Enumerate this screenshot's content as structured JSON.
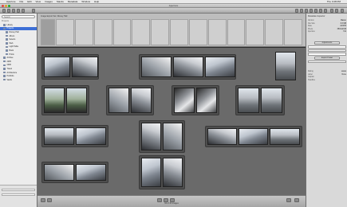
{
  "menubar": {
    "items": [
      "Aperture",
      "File",
      "Edit",
      "View",
      "Images",
      "Stacks",
      "Metadata",
      "Window",
      "Help"
    ],
    "right": [
      "Thu 3:28 PM"
    ]
  },
  "titlebar": {
    "title": "Aperture"
  },
  "sidebar": {
    "search_placeholder": "Search",
    "header": "Projects",
    "items": [
      {
        "label": "Library",
        "selected": false,
        "indent": false
      },
      {
        "label": "Projects",
        "selected": true,
        "indent": false
      },
      {
        "label": "Disney Hall",
        "selected": false,
        "indent": true
      },
      {
        "label": "Album",
        "selected": false,
        "indent": true
      },
      {
        "label": "Selects",
        "selected": false,
        "indent": true
      },
      {
        "label": "Web",
        "selected": false,
        "indent": true
      },
      {
        "label": "Light Table",
        "selected": false,
        "indent": true
      },
      {
        "label": "Book",
        "selected": false,
        "indent": true
      },
      {
        "label": "Prints",
        "selected": false,
        "indent": true
      },
      {
        "label": "Archive",
        "selected": false,
        "indent": false
      },
      {
        "label": "2005",
        "selected": false,
        "indent": false
      },
      {
        "label": "2006",
        "selected": false,
        "indent": false
      },
      {
        "label": "Travel",
        "selected": false,
        "indent": false
      },
      {
        "label": "Architecture",
        "selected": false,
        "indent": false
      },
      {
        "label": "Portfolio",
        "selected": false,
        "indent": false
      },
      {
        "label": "Vaults",
        "selected": false,
        "indent": false
      }
    ]
  },
  "filmstrip": {
    "header": "Image Export Set: Disney Hall"
  },
  "inspector": {
    "title": "Metadata Inspector",
    "sections": {
      "info": {
        "rows": [
          {
            "k": "Version",
            "v": "Master"
          },
          {
            "k": "File Size",
            "v": "8.3 MB"
          },
          {
            "k": "Date",
            "v": "4/23/06"
          },
          {
            "k": "Pixels",
            "v": "3504x2336"
          },
          {
            "k": "Aperture",
            "v": "f/11"
          }
        ]
      },
      "buttons": [
        "Adjustments",
        "Export Preset"
      ],
      "keywords": {
        "rows": [
          {
            "k": "Rating",
            "v": "★★★"
          },
          {
            "k": "Label",
            "v": "None"
          },
          {
            "k": "Caption",
            "v": ""
          },
          {
            "k": "Headline",
            "v": ""
          }
        ]
      }
    }
  },
  "status": {
    "text": "34 of 34 images"
  }
}
